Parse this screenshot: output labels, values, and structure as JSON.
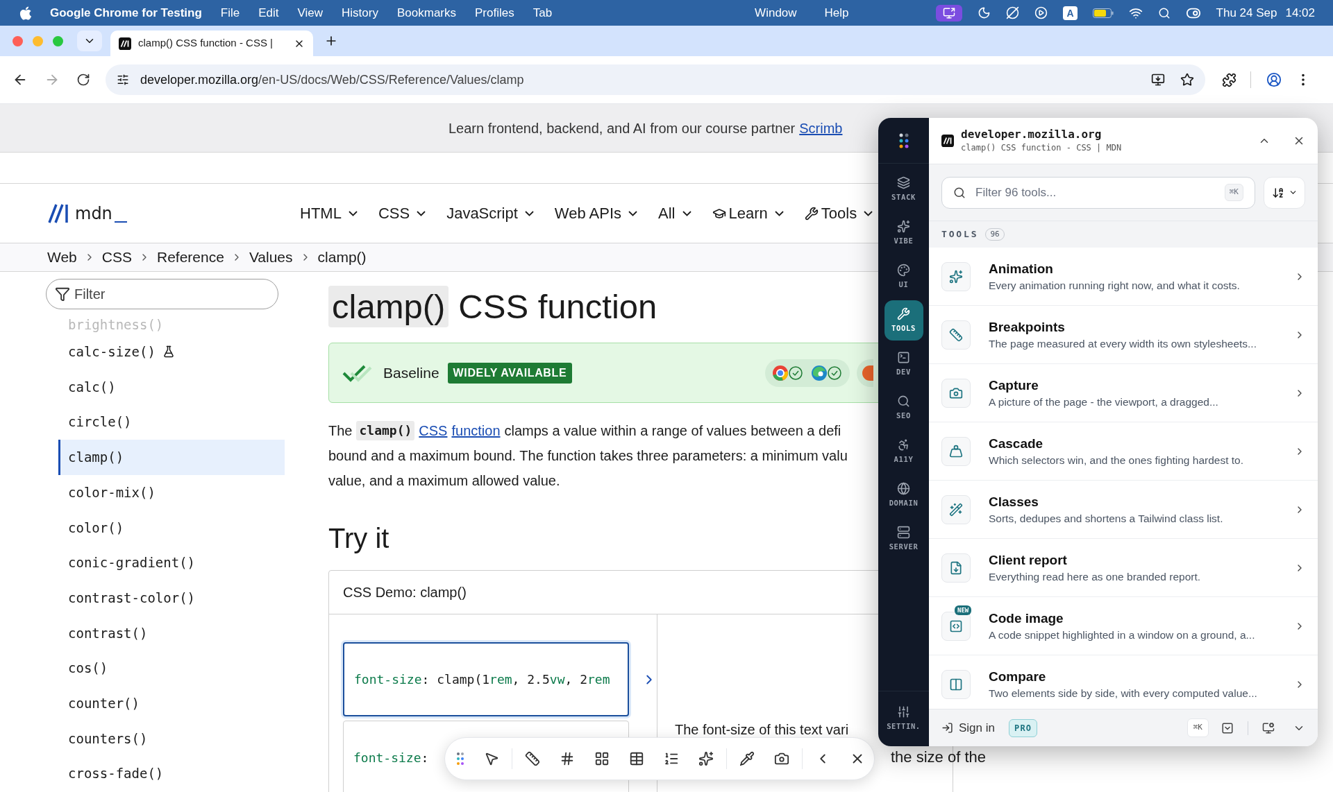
{
  "menu_bar": {
    "app": "Google Chrome for Testing",
    "menus": [
      "File",
      "Edit",
      "View",
      "History",
      "Bookmarks",
      "Profiles",
      "Tab"
    ],
    "menus_right": [
      "Window",
      "Help"
    ],
    "input_source": "A",
    "date": "Thu 24 Sep",
    "time": "14:02"
  },
  "browser": {
    "tab_title": "clamp() CSS function - CSS |",
    "url_host": "developer.mozilla.org",
    "url_path": "/en-US/docs/Web/CSS/Reference/Values/clamp"
  },
  "page": {
    "banner": {
      "text": "Learn frontend, backend, and AI from our course partner",
      "link": "Scrimb"
    },
    "logo_text": "mdn",
    "nav": [
      {
        "label": "HTML",
        "kind": "plain"
      },
      {
        "label": "CSS",
        "kind": "plain"
      },
      {
        "label": "JavaScript",
        "kind": "plain"
      },
      {
        "label": "Web APIs",
        "kind": "plain"
      },
      {
        "label": "All",
        "kind": "plain"
      },
      {
        "label": "Learn",
        "kind": "icon"
      },
      {
        "label": "Tools",
        "kind": "icon"
      }
    ],
    "breadcrumb": [
      "Web",
      "CSS",
      "Reference",
      "Values",
      "clamp()"
    ],
    "sidebar": {
      "filter_placeholder": "Filter",
      "items": [
        {
          "label": "brightness()",
          "faded": true,
          "experimental": false,
          "selected": false
        },
        {
          "label": "calc-size()",
          "faded": false,
          "experimental": true,
          "selected": false
        },
        {
          "label": "calc()",
          "faded": false,
          "experimental": false,
          "selected": false
        },
        {
          "label": "circle()",
          "faded": false,
          "experimental": false,
          "selected": false
        },
        {
          "label": "clamp()",
          "faded": false,
          "experimental": false,
          "selected": true
        },
        {
          "label": "color-mix()",
          "faded": false,
          "experimental": false,
          "selected": false
        },
        {
          "label": "color()",
          "faded": false,
          "experimental": false,
          "selected": false
        },
        {
          "label": "conic-gradient()",
          "faded": false,
          "experimental": false,
          "selected": false
        },
        {
          "label": "contrast-color()",
          "faded": false,
          "experimental": false,
          "selected": false
        },
        {
          "label": "contrast()",
          "faded": false,
          "experimental": false,
          "selected": false
        },
        {
          "label": "cos()",
          "faded": false,
          "experimental": false,
          "selected": false
        },
        {
          "label": "counter()",
          "faded": false,
          "experimental": false,
          "selected": false
        },
        {
          "label": "counters()",
          "faded": false,
          "experimental": false,
          "selected": false
        },
        {
          "label": "cross-fade()",
          "faded": false,
          "experimental": false,
          "selected": false
        }
      ]
    },
    "article": {
      "title_code": "clamp()",
      "title_rest": "CSS function",
      "baseline": {
        "label": "Baseline",
        "badge": "WIDELY AVAILABLE"
      },
      "intro": [
        {
          "parts": [
            {
              "kind": "text",
              "t": "The"
            },
            {
              "kind": "code",
              "t": "clamp()"
            },
            {
              "kind": "link",
              "t": "CSS"
            },
            {
              "kind": "link",
              "t": "function"
            },
            {
              "kind": "text",
              "t": "clamps a value within a range of values between a defi"
            }
          ]
        },
        {
          "parts": [
            {
              "kind": "text",
              "t": "bound and a maximum bound. The function takes three parameters: a minimum valu"
            }
          ]
        },
        {
          "parts": [
            {
              "kind": "text",
              "t": "value, and a maximum allowed value."
            }
          ]
        }
      ],
      "try_it": "Try it",
      "demo": {
        "title": "CSS Demo: clamp()",
        "code_boxes": [
          {
            "selected": true,
            "tokens": [
              {
                "t": "font-size",
                "kind": "prop"
              },
              {
                "t": ": clamp(1",
                "kind": "plain"
              },
              {
                "t": "rem",
                "kind": "unit"
              },
              {
                "t": ", 2.5",
                "kind": "plain"
              },
              {
                "t": "vw",
                "kind": "unit"
              },
              {
                "t": ", 2",
                "kind": "plain"
              },
              {
                "t": "rem",
                "kind": "unit"
              }
            ]
          },
          {
            "selected": false,
            "tokens": [
              {
                "t": "font-size",
                "kind": "prop"
              },
              {
                "t": ":",
                "kind": "plain"
              }
            ]
          }
        ],
        "output_lines": [
          "The font-size of this text vari",
          "the size of the"
        ]
      }
    }
  },
  "panel": {
    "site": "developer.mozilla.org",
    "page_title": "clamp() CSS function - CSS | MDN",
    "rail": [
      {
        "label": "STACK",
        "selected": false
      },
      {
        "label": "VIBE",
        "selected": false
      },
      {
        "label": "UI",
        "selected": false
      },
      {
        "label": "TOOLS",
        "selected": true
      },
      {
        "label": "DEV",
        "selected": false
      },
      {
        "label": "SEO",
        "selected": false
      },
      {
        "label": "A11Y",
        "selected": false
      },
      {
        "label": "DOMAIN",
        "selected": false
      },
      {
        "label": "SERVER",
        "selected": false
      }
    ],
    "settings_label": "SETTIN.",
    "search": {
      "placeholder": "Filter 96 tools...",
      "shortcut": "⌘K"
    },
    "section": {
      "label": "TOOLS",
      "count": "96"
    },
    "tools": [
      {
        "title": "Animation",
        "description": "Every animation running right now, and what it costs."
      },
      {
        "title": "Breakpoints",
        "description": "The page measured at every width its own stylesheets..."
      },
      {
        "title": "Capture",
        "description": "A picture of the page - the viewport, a dragged..."
      },
      {
        "title": "Cascade",
        "description": "Which selectors win, and the ones fighting hardest to."
      },
      {
        "title": "Classes",
        "description": "Sorts, dedupes and shortens a Tailwind class list."
      },
      {
        "title": "Client report",
        "description": "Everything read here as one branded report."
      },
      {
        "title": "Code image",
        "badge": "NEW",
        "description": "A code snippet highlighted in a window on a ground, a..."
      },
      {
        "title": "Compare",
        "description": "Two elements side by side, with every computed value..."
      }
    ],
    "footer": {
      "sign_in": "Sign in",
      "plan": "PRO",
      "shortcut": "⌘K"
    }
  }
}
